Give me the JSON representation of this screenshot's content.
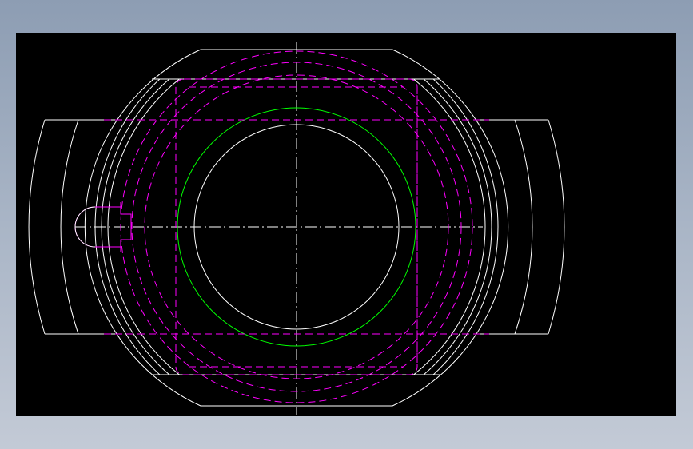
{
  "colors": {
    "background": "#000000",
    "outline": "#ffffff",
    "hidden": "#ff00ff",
    "highlight": "#00ff00",
    "centerline": "#ffffff"
  },
  "layers": [
    {
      "name": "visible-outline",
      "linetype": "continuous",
      "color": "#ffffff"
    },
    {
      "name": "hidden-lines",
      "linetype": "dashed",
      "color": "#ff00ff"
    },
    {
      "name": "centerlines",
      "linetype": "dash-dot",
      "color": "#ffffff"
    },
    {
      "name": "highlighted-circle",
      "linetype": "continuous",
      "color": "#00ff00"
    }
  ]
}
